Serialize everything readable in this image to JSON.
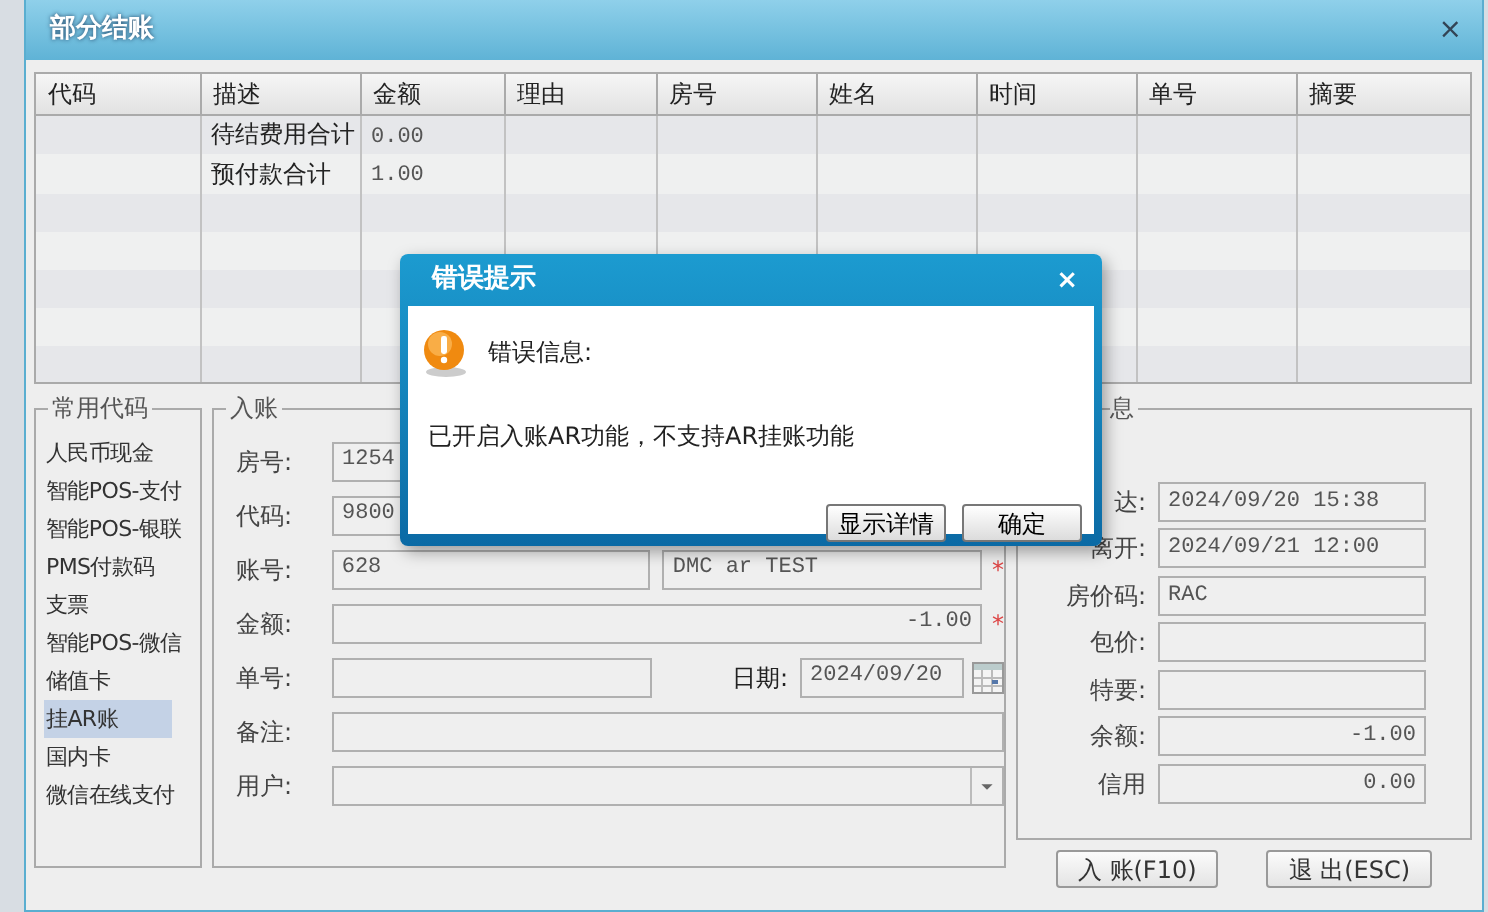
{
  "window": {
    "title": "部分结账",
    "close": "×"
  },
  "table": {
    "columns": [
      "代码",
      "描述",
      "金额",
      "理由",
      "房号",
      "姓名",
      "时间",
      "单号",
      "摘要"
    ],
    "rows": [
      {
        "description": "待结费用合计",
        "amount": "0.00"
      },
      {
        "description": "预付款合计",
        "amount": "1.00"
      }
    ]
  },
  "common_codes": {
    "title": "常用代码",
    "items": [
      {
        "label": "人民币现金",
        "selected": false
      },
      {
        "label": "智能POS-支付",
        "selected": false
      },
      {
        "label": "智能POS-银联",
        "selected": false
      },
      {
        "label": "PMS付款码",
        "selected": false
      },
      {
        "label": "支票",
        "selected": false
      },
      {
        "label": "智能POS-微信",
        "selected": false
      },
      {
        "label": "储值卡",
        "selected": false
      },
      {
        "label": "挂AR账",
        "selected": true
      },
      {
        "label": "国内卡",
        "selected": false
      },
      {
        "label": "微信在线支付",
        "selected": false
      }
    ]
  },
  "entry": {
    "title": "入账",
    "room": {
      "label": "房号:",
      "value": "1254"
    },
    "code": {
      "label": "代码:",
      "value": "9800"
    },
    "account": {
      "label": "账号:",
      "value": "628",
      "name": "DMC ar TEST",
      "required_mark": "*"
    },
    "amount": {
      "label": "金额:",
      "value": "-1.00",
      "required_mark": "*"
    },
    "number": {
      "label": "单号:"
    },
    "date": {
      "label": "日期:",
      "value": "2024/09/20"
    },
    "note": {
      "label": "备注:"
    },
    "user": {
      "label": "用户:"
    }
  },
  "info": {
    "title": "息",
    "rows": [
      {
        "label": "达:",
        "value": "2024/09/20 15:38",
        "kind": "text"
      },
      {
        "label": "离开:",
        "value": "2024/09/21 12:00",
        "kind": "text"
      },
      {
        "label": "房价码:",
        "value": "RAC",
        "kind": "text"
      },
      {
        "label": "包价:",
        "kind": "text"
      },
      {
        "label": "特要:",
        "kind": "text"
      },
      {
        "label": "余额:",
        "value": "-1.00",
        "kind": "amount"
      },
      {
        "label": "信用",
        "value": "0.00",
        "kind": "amount"
      }
    ]
  },
  "buttons": [
    "入 账(F10)",
    "退 出(ESC)"
  ],
  "dialog": {
    "title": "错误提示",
    "close": "×",
    "heading": "错误信息:",
    "message": "已开启入账AR功能，不支持AR挂账功能",
    "buttons": [
      "显示详情",
      "确定"
    ]
  }
}
